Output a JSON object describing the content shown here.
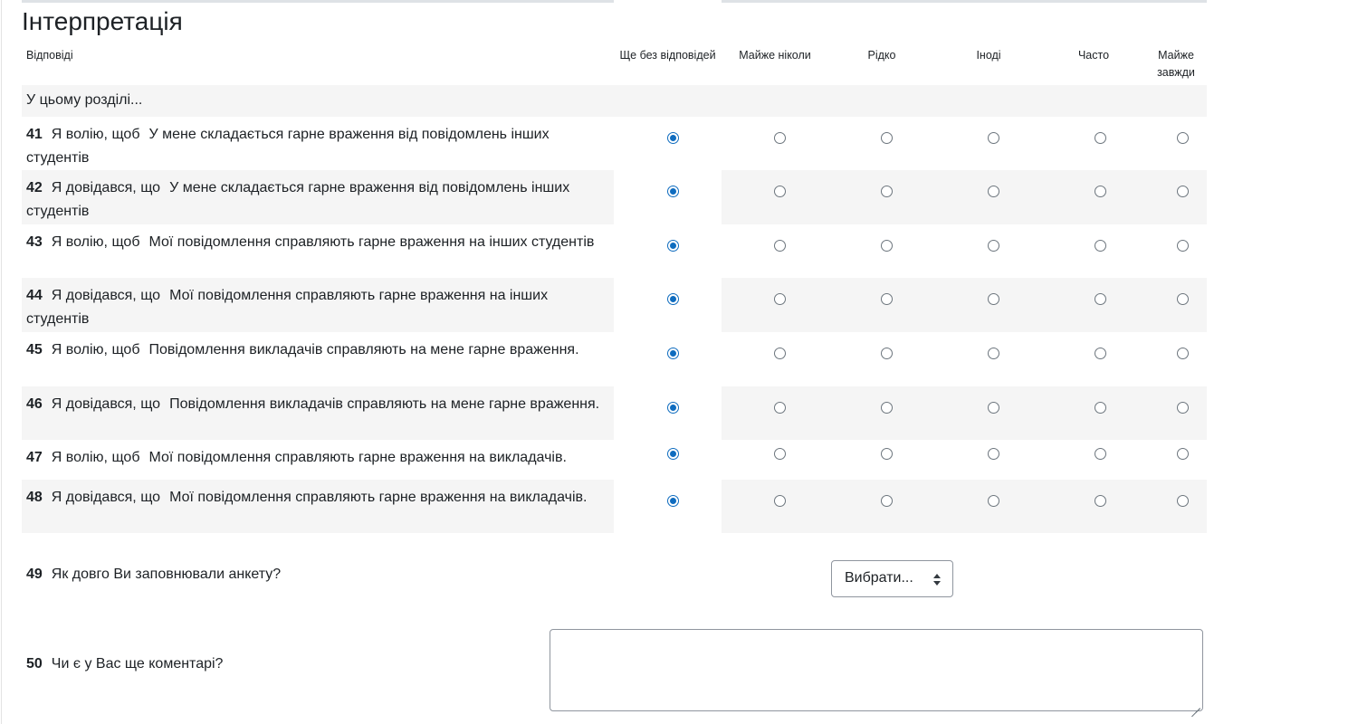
{
  "section": {
    "title": "Інтерпретація",
    "intro": "У цьому розділі..."
  },
  "columns": {
    "answers": "Відповіді",
    "options": [
      "Ще без відповідей",
      "Майже ніколи",
      "Рідко",
      "Іноді",
      "Часто",
      "Майже завжди"
    ]
  },
  "questions": [
    {
      "num": "41",
      "prefix": "Я волію, щоб",
      "text": "У мене складається гарне враження від повідомлень інших студентів",
      "selected": 0
    },
    {
      "num": "42",
      "prefix": "Я довідався, що",
      "text": "У мене складається гарне враження від повідомлень інших студентів",
      "selected": 0
    },
    {
      "num": "43",
      "prefix": "Я волію, щоб",
      "text": "Мої повідомлення справляють гарне враження на інших студентів",
      "selected": 0
    },
    {
      "num": "44",
      "prefix": "Я довідався, що",
      "text": "Мої повідомлення справляють гарне враження на інших студентів",
      "selected": 0
    },
    {
      "num": "45",
      "prefix": "Я волію, щоб",
      "text": "Повідомлення викладачів справляють на мене гарне враження.",
      "selected": 0
    },
    {
      "num": "46",
      "prefix": "Я довідався, що",
      "text": "Повідомлення викладачів справляють на мене гарне враження.",
      "selected": 0
    },
    {
      "num": "47",
      "prefix": "Я волію, щоб",
      "text": "Мої повідомлення справляють гарне враження на викладачів.",
      "selected": 0
    },
    {
      "num": "48",
      "prefix": "Я довідався, що",
      "text": "Мої повідомлення справляють гарне враження на викладачів.",
      "selected": 0
    }
  ],
  "q49": {
    "num": "49",
    "text": "Як довго Ви заповнювали анкету?",
    "selected": "Вибрати..."
  },
  "q50": {
    "num": "50",
    "text": "Чи є у Вас ще коментарі?",
    "value": ""
  },
  "colors": {
    "accent": "#0f6cbf",
    "row_shade": "#f5f5f5"
  }
}
